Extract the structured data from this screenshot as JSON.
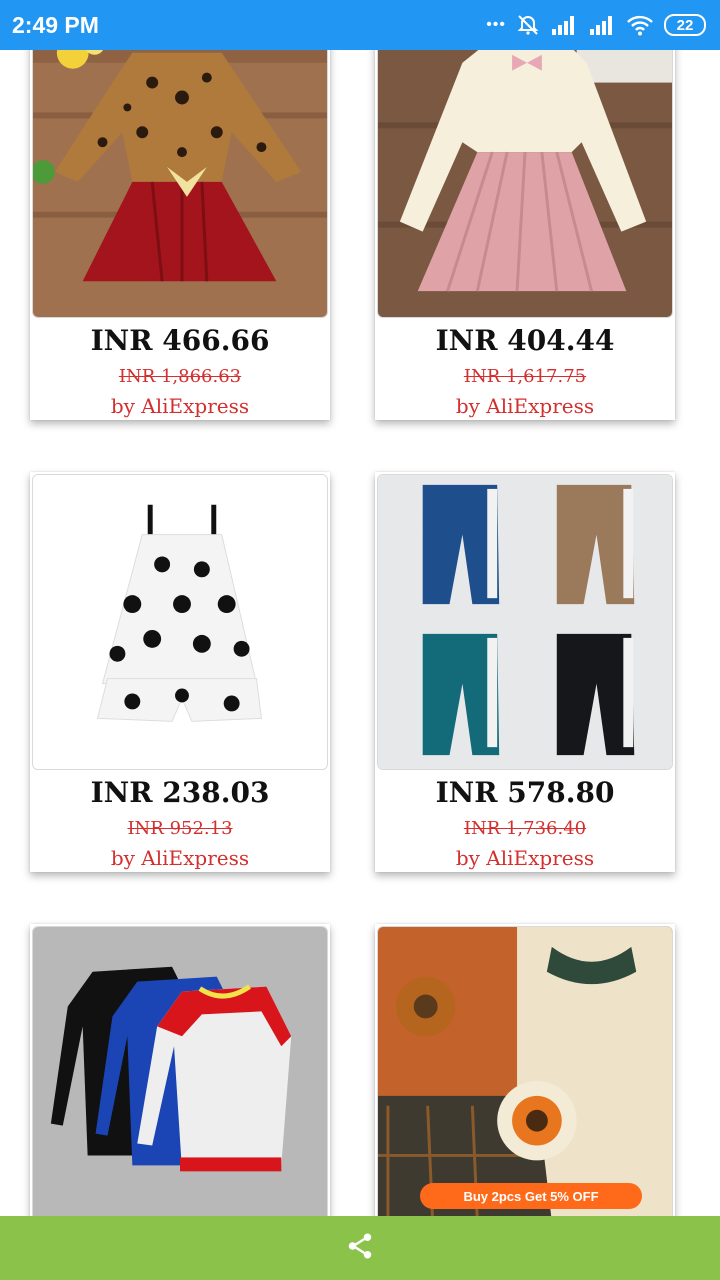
{
  "status_bar": {
    "time": "2:49 PM",
    "battery": "22",
    "dots": "•••"
  },
  "products": [
    {
      "price": "INR 466.66",
      "old_price": "INR 1,866.63",
      "seller": "by AliExpress",
      "image": "leopard-print-tutu-dress"
    },
    {
      "price": "INR 404.44",
      "old_price": "INR 1,617.75",
      "seller": "by AliExpress",
      "image": "cream-sweater-pink-pleated-skirt"
    },
    {
      "price": "INR 238.03",
      "old_price": "INR 952.13",
      "seller": "by AliExpress",
      "image": "polka-dot-top-shorts-set"
    },
    {
      "price": "INR 578.80",
      "old_price": "INR 1,736.40",
      "seller": "by AliExpress",
      "image": "kids-jogger-pants-four-colors"
    },
    {
      "price": "",
      "old_price": "",
      "seller": "",
      "image": "raglan-sweatshirts"
    },
    {
      "price": "",
      "old_price": "",
      "seller": "",
      "image": "sunflower-bag-outfit",
      "promo": "Buy 2pcs Get 5% OFF"
    }
  ],
  "bottom_bar": {
    "icon": "share-icon",
    "color": "#8bc34a"
  },
  "colors": {
    "status_bar": "#2196f3",
    "price_old": "#d32f2f",
    "seller": "#d32f2f"
  }
}
